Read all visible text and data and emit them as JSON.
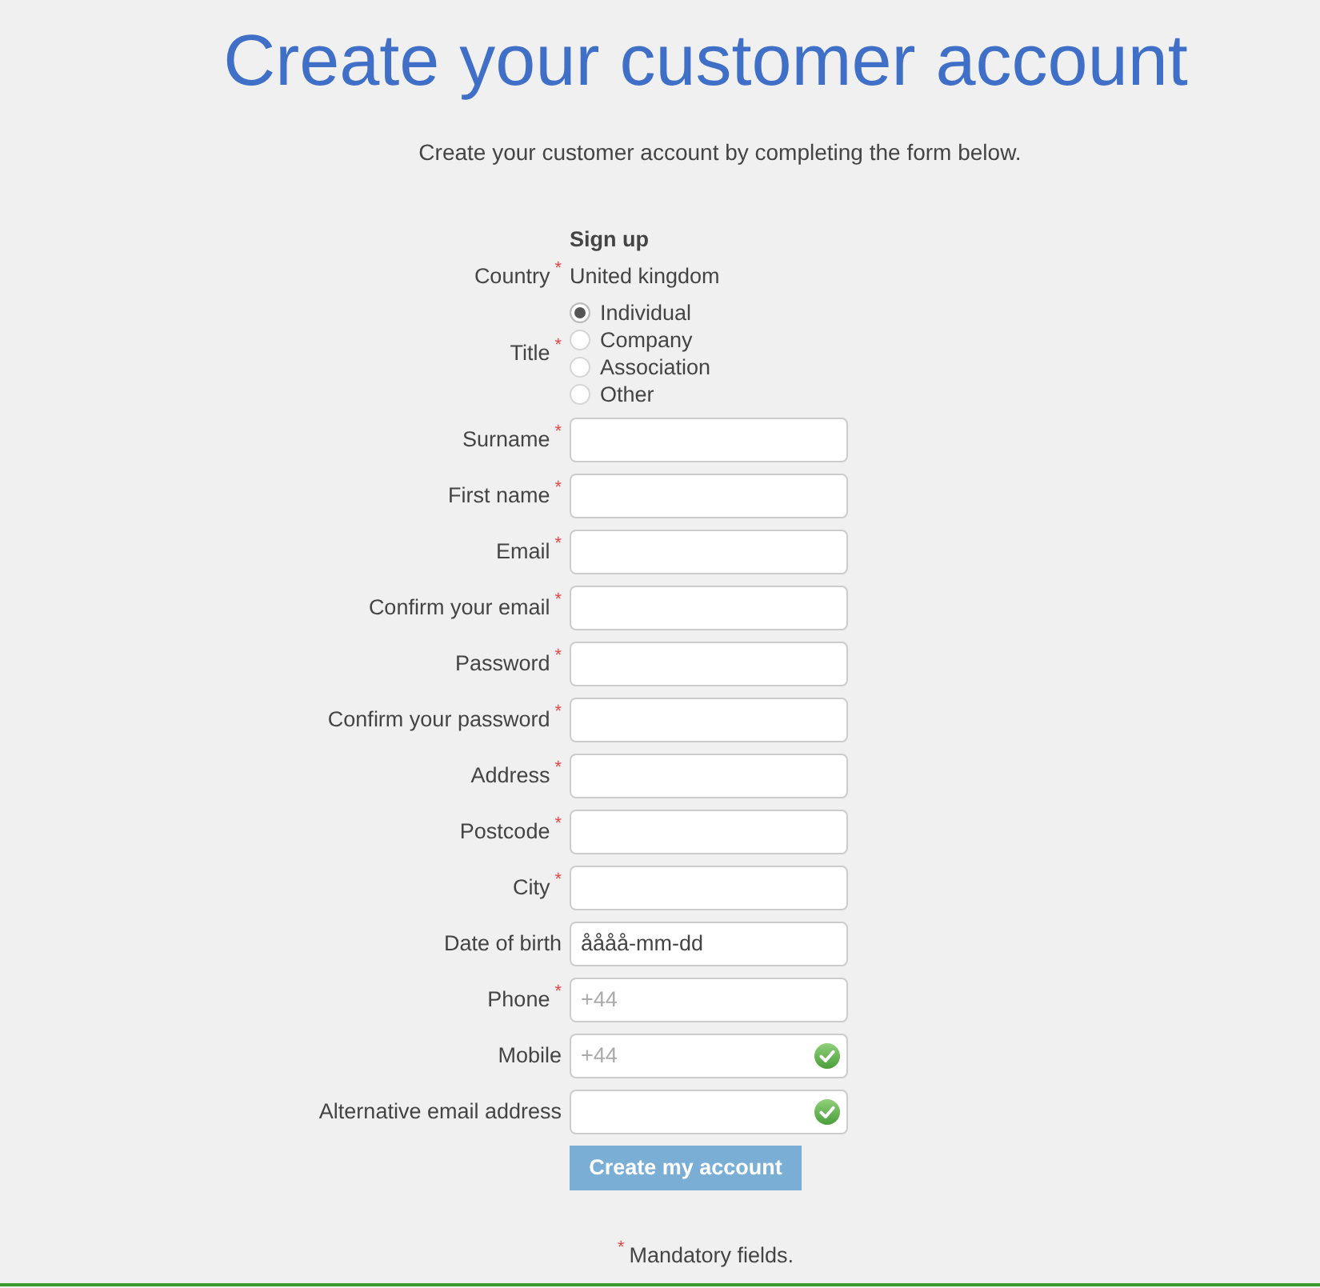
{
  "heading": "Create your customer account",
  "intro": "Create your customer account by completing the form below.",
  "form": {
    "title": "Sign up",
    "required_mark": "*",
    "fields": [
      {
        "kind": "static",
        "label": "Country",
        "required": true,
        "value": "United kingdom"
      },
      {
        "kind": "radio",
        "label": "Title",
        "required": true,
        "options": [
          {
            "label": "Individual",
            "selected": true
          },
          {
            "label": "Company",
            "selected": false
          },
          {
            "label": "Association",
            "selected": false
          },
          {
            "label": "Other",
            "selected": false
          }
        ]
      },
      {
        "kind": "text",
        "label": "Surname",
        "required": true
      },
      {
        "kind": "text",
        "label": "First name",
        "required": true
      },
      {
        "kind": "text",
        "label": "Email",
        "required": true
      },
      {
        "kind": "text",
        "label": "Confirm your email",
        "required": true
      },
      {
        "kind": "text",
        "label": "Password",
        "required": true
      },
      {
        "kind": "text",
        "label": "Confirm your password",
        "required": true
      },
      {
        "kind": "text",
        "label": "Address",
        "required": true
      },
      {
        "kind": "text",
        "label": "Postcode",
        "required": true
      },
      {
        "kind": "text",
        "label": "City",
        "required": true
      },
      {
        "kind": "text",
        "label": "Date of birth",
        "required": false,
        "value": "åååå-mm-dd"
      },
      {
        "kind": "text",
        "label": "Phone",
        "required": true,
        "placeholder": "+44"
      },
      {
        "kind": "text",
        "label": "Mobile",
        "required": false,
        "placeholder": "+44",
        "valid": true
      },
      {
        "kind": "text",
        "label": "Alternative email address",
        "required": false,
        "valid": true
      }
    ],
    "submit": "Create my account"
  },
  "footnote": {
    "mark": "*",
    "text": "Mandatory fields."
  }
}
